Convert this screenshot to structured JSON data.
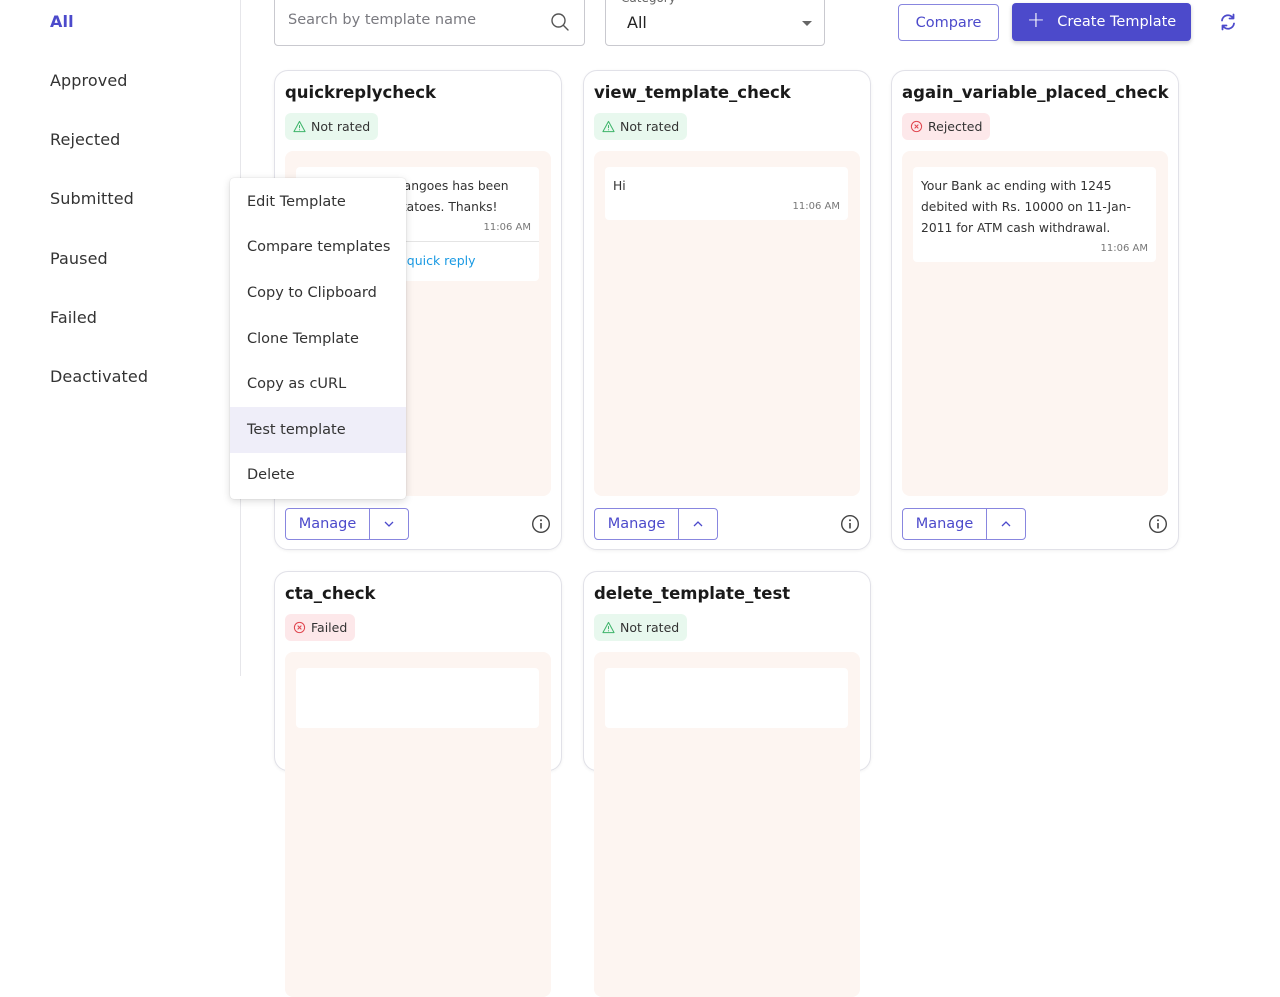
{
  "sidebar": {
    "items": [
      {
        "label": "All",
        "active": true
      },
      {
        "label": "Approved"
      },
      {
        "label": "Rejected"
      },
      {
        "label": "Submitted"
      },
      {
        "label": "Paused"
      },
      {
        "label": "Failed"
      },
      {
        "label": "Deactivated"
      }
    ]
  },
  "toolbar": {
    "search_placeholder": "Search by template name",
    "search_value": "",
    "category_label": "Category",
    "category_value": "All",
    "compare_label": "Compare",
    "create_label": "Create Template",
    "accent_color": "#4c4acb"
  },
  "cards": [
    {
      "title": "quickreplycheck",
      "status": "Not rated",
      "status_type": "warning",
      "message": "Your order for mangoes has been shipped with potatoes. Thanks!",
      "time": "11:06 AM",
      "quick_reply": "testing quick reply",
      "manage_label": "Manage",
      "toggle": "chevron-down"
    },
    {
      "title": "view_template_check",
      "status": "Not rated",
      "status_type": "warning",
      "message": "Hi",
      "time": "11:06 AM",
      "manage_label": "Manage",
      "toggle": "chevron-up"
    },
    {
      "title": "again_variable_placed_check",
      "status": "Rejected",
      "status_type": "error",
      "message": "Your Bank ac ending with 1245 debited with Rs. 10000 on 11-Jan-2011 for ATM cash withdrawal.",
      "time": "11:06 AM",
      "manage_label": "Manage",
      "toggle": "chevron-up"
    },
    {
      "title": "cta_check",
      "status": "Failed",
      "status_type": "error"
    },
    {
      "title": "delete_template_test",
      "status": "Not rated",
      "status_type": "warning"
    }
  ],
  "context_menu": {
    "items": [
      {
        "label": "Edit Template"
      },
      {
        "label": "Compare templates"
      },
      {
        "label": "Copy to Clipboard"
      },
      {
        "label": "Clone Template"
      },
      {
        "label": "Copy as cURL"
      },
      {
        "label": "Test template",
        "hovered": true
      },
      {
        "label": "Delete"
      }
    ]
  }
}
